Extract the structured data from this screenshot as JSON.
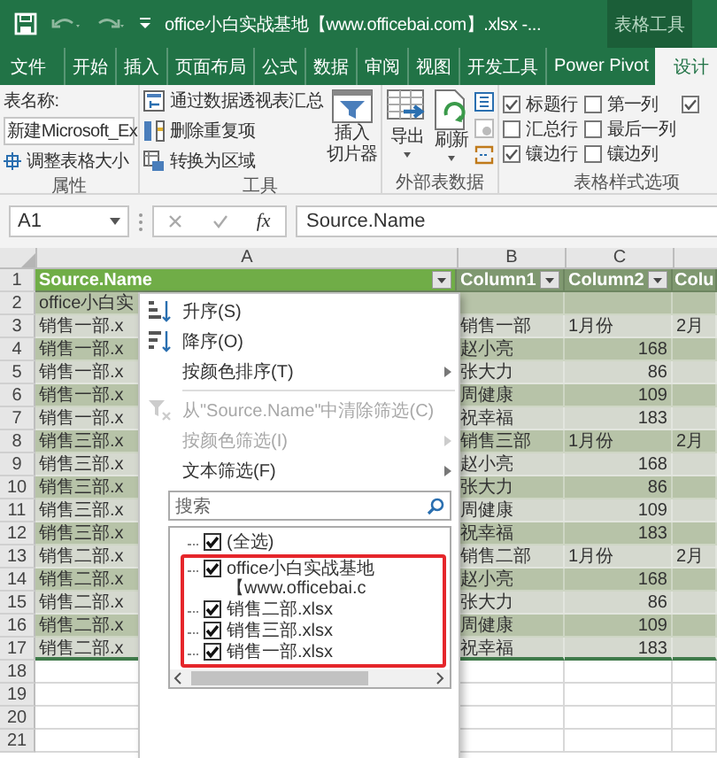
{
  "title_bar": {
    "title": "office小白实战基地【www.officebai.com】.xlsx -...",
    "context_label": "表格工具"
  },
  "tabs": [
    {
      "label": "文件",
      "selected": false
    },
    {
      "label": "开始",
      "selected": false
    },
    {
      "label": "插入",
      "selected": false
    },
    {
      "label": "页面布局",
      "selected": false
    },
    {
      "label": "公式",
      "selected": false
    },
    {
      "label": "数据",
      "selected": false
    },
    {
      "label": "审阅",
      "selected": false
    },
    {
      "label": "视图",
      "selected": false
    },
    {
      "label": "开发工具",
      "selected": false
    },
    {
      "label": "Power Pivot",
      "selected": false
    },
    {
      "label": "设计",
      "selected": true
    }
  ],
  "ribbon": {
    "properties": {
      "name_label": "表名称:",
      "table_name": "新建Microsoft_Ex",
      "resize": "调整表格大小",
      "caption": "属性"
    },
    "tools": {
      "commands": [
        {
          "label": "通过数据透视表汇总",
          "kind": "pivot"
        },
        {
          "label": "删除重复项",
          "kind": "dedupe"
        },
        {
          "label": "转换为区域",
          "kind": "convert"
        }
      ],
      "slicer": [
        "插入",
        "切片器"
      ],
      "caption": "工具"
    },
    "external": {
      "buttons": [
        {
          "label": "导出",
          "kind": "export"
        },
        {
          "label": "刷新",
          "kind": "refresh"
        }
      ],
      "caption": "外部表数据"
    },
    "style_options": {
      "options": [
        {
          "label": "标题行",
          "checked": true
        },
        {
          "label": "汇总行",
          "checked": false
        },
        {
          "label": "镶边行",
          "checked": true
        },
        {
          "label": "第一列",
          "checked": false
        },
        {
          "label": "最后一列",
          "checked": false
        },
        {
          "label": "镶边列",
          "checked": false
        },
        {
          "checked": true
        }
      ],
      "caption": "表格样式选项"
    }
  },
  "formula_bar": {
    "name_box": "A1",
    "insert_function": "fx",
    "formula": "Source.Name"
  },
  "columns": [
    "A",
    "B",
    "C"
  ],
  "rows": [
    {
      "number": "1",
      "kind": "header",
      "cells": [
        "Source.Name",
        "Column1",
        "Column2",
        "Colu"
      ]
    },
    {
      "number": "2",
      "kind": "data",
      "cells": [
        "office小白实"
      ]
    },
    {
      "number": "3",
      "kind": "group",
      "cells": [
        "销售一部.x",
        "销售一部",
        "1月份",
        "2月"
      ]
    },
    {
      "number": "4",
      "kind": "person",
      "cells": [
        "销售一部.x",
        "赵小亮",
        "168"
      ]
    },
    {
      "number": "5",
      "kind": "person",
      "cells": [
        "销售一部.x",
        "张大力",
        "86"
      ]
    },
    {
      "number": "6",
      "kind": "person",
      "cells": [
        "销售一部.x",
        "周健康",
        "109"
      ]
    },
    {
      "number": "7",
      "kind": "person",
      "cells": [
        "销售一部.x",
        "祝幸福",
        "183"
      ]
    },
    {
      "number": "8",
      "kind": "group",
      "cells": [
        "销售三部.x",
        "销售三部",
        "1月份",
        "2月"
      ]
    },
    {
      "number": "9",
      "kind": "person",
      "cells": [
        "销售三部.x",
        "赵小亮",
        "168"
      ]
    },
    {
      "number": "10",
      "kind": "person",
      "cells": [
        "销售三部.x",
        "张大力",
        "86"
      ]
    },
    {
      "number": "11",
      "kind": "person",
      "cells": [
        "销售三部.x",
        "周健康",
        "109"
      ]
    },
    {
      "number": "12",
      "kind": "person",
      "cells": [
        "销售三部.x",
        "祝幸福",
        "183"
      ]
    },
    {
      "number": "13",
      "kind": "group",
      "cells": [
        "销售二部.x",
        "销售二部",
        "1月份",
        "2月"
      ]
    },
    {
      "number": "14",
      "kind": "person",
      "cells": [
        "销售二部.x",
        "赵小亮",
        "168"
      ]
    },
    {
      "number": "15",
      "kind": "person",
      "cells": [
        "销售二部.x",
        "张大力",
        "86"
      ]
    },
    {
      "number": "16",
      "kind": "person",
      "cells": [
        "销售二部.x",
        "周健康",
        "109"
      ]
    },
    {
      "number": "17",
      "kind": "person",
      "cells": [
        "销售二部.x",
        "祝幸福",
        "183"
      ]
    },
    {
      "number": "18",
      "kind": "blank"
    },
    {
      "number": "19",
      "kind": "blank"
    },
    {
      "number": "20",
      "kind": "blank"
    },
    {
      "number": "21",
      "kind": "blank"
    }
  ],
  "filter_menu": {
    "items": [
      {
        "label": "升序(S)",
        "kind": "sort-asc",
        "disabled": false,
        "submenu": false
      },
      {
        "label": "降序(O)",
        "kind": "sort-desc",
        "disabled": false,
        "submenu": false
      },
      {
        "label": "按颜色排序(T)",
        "kind": "plain",
        "disabled": false,
        "submenu": true
      },
      {
        "kind": "separator"
      },
      {
        "label": "从\"Source.Name\"中清除筛选(C)",
        "kind": "clear-filter",
        "disabled": true,
        "submenu": false
      },
      {
        "label": "按颜色筛选(I)",
        "kind": "plain",
        "disabled": true,
        "submenu": true
      },
      {
        "label": "文本筛选(F)",
        "kind": "plain",
        "disabled": false,
        "submenu": true
      }
    ],
    "search": {
      "placeholder": "搜索"
    },
    "select_all": {
      "label": "(全选)",
      "checked": true
    },
    "values": [
      {
        "label": "office小白实战基地【www.officebai.c",
        "checked": true
      },
      {
        "label": "销售二部.xlsx",
        "checked": true
      },
      {
        "label": "销售三部.xlsx",
        "checked": true
      },
      {
        "label": "销售一部.xlsx",
        "checked": true
      }
    ],
    "values_highlighted": true
  }
}
